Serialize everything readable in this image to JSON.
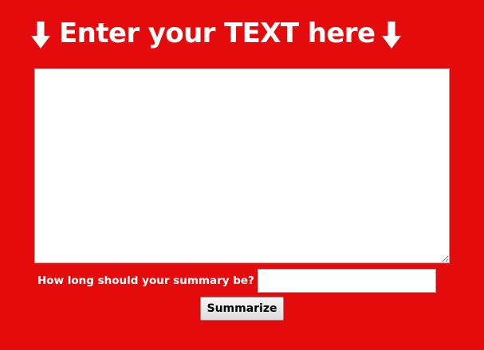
{
  "header": {
    "title": "Enter your TEXT here",
    "left_icon": "arrow-down-icon",
    "right_icon": "arrow-down-icon"
  },
  "text_input": {
    "value": "",
    "placeholder": ""
  },
  "summary_length": {
    "label": "How long should your summary be?",
    "value": "",
    "placeholder": ""
  },
  "submit": {
    "label": "Summarize"
  },
  "colors": {
    "background": "#e30b0b",
    "text": "#ffffff"
  }
}
